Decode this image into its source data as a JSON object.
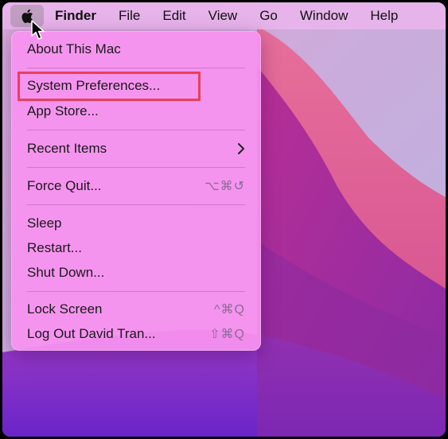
{
  "menubar": {
    "items": [
      "Finder",
      "File",
      "Edit",
      "View",
      "Go",
      "Window",
      "Help"
    ],
    "active_color": "#7a7a7a"
  },
  "apple_menu": {
    "about": "About This Mac",
    "system_preferences": "System Preferences...",
    "app_store": "App Store...",
    "recent_items": "Recent Items",
    "force_quit": "Force Quit...",
    "force_quit_shortcut": "⌥⌘↺",
    "sleep": "Sleep",
    "restart": "Restart...",
    "shut_down": "Shut Down...",
    "lock_screen": "Lock Screen",
    "lock_screen_shortcut": "^⌘Q",
    "log_out": "Log Out David Tran...",
    "log_out_shortcut": "⇧⌘Q"
  },
  "colors": {
    "highlight_box": "#e8405a",
    "menu_background": "#f892f0",
    "menubar_background": "#e8b4eb"
  },
  "icons": {
    "apple": "apple-logo-icon",
    "submenu": "chevron-right-icon",
    "cursor": "mouse-pointer-icon"
  }
}
